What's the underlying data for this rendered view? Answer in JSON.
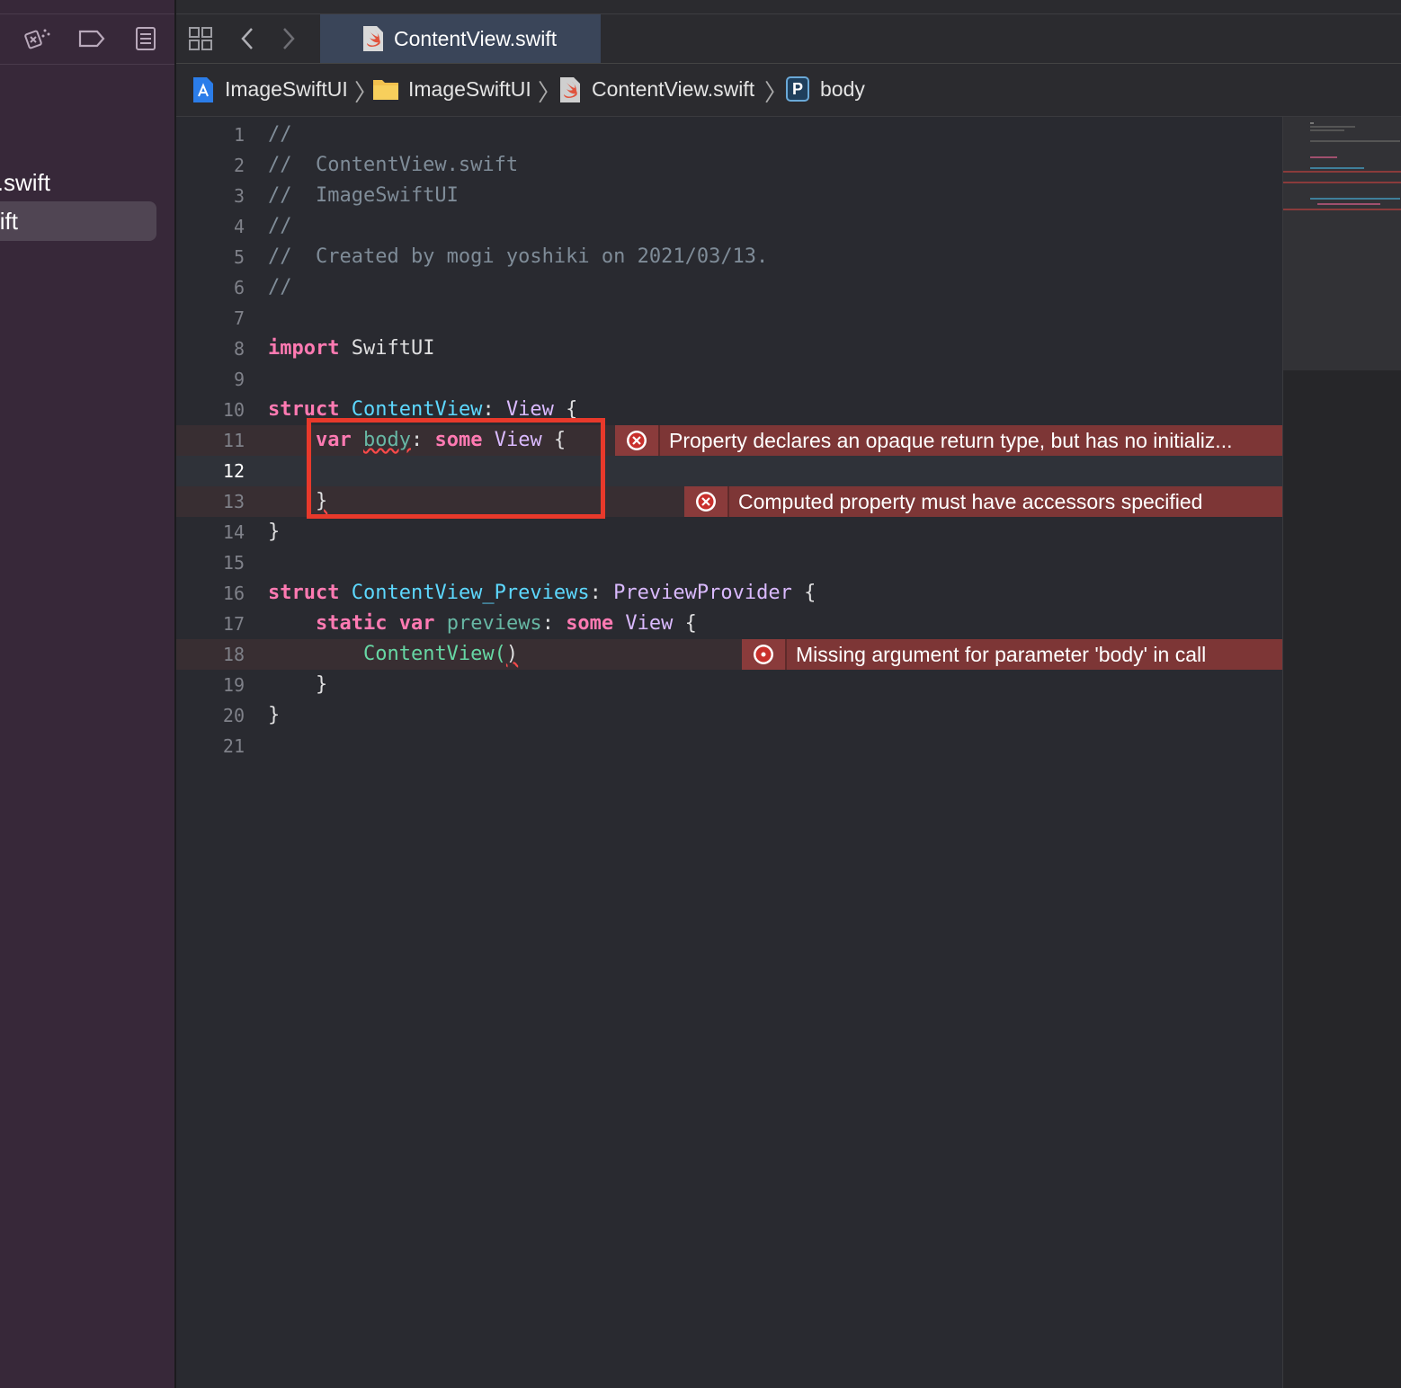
{
  "sidebar": {
    "files": [
      {
        "label": "p.swift",
        "selected": false
      },
      {
        "label": "ift",
        "selected": true
      }
    ],
    "icons": [
      "test-navigator-icon",
      "breakpoint-icon",
      "report-icon"
    ]
  },
  "tabbar": {
    "active_tab": "ContentView.swift",
    "icons": [
      "grid-icon",
      "back-icon",
      "forward-icon",
      "swift-file-icon"
    ]
  },
  "breadcrumb": {
    "items": [
      "ImageSwiftUI",
      "ImageSwiftUI",
      "ContentView.swift",
      "body"
    ],
    "property_badge": "P"
  },
  "editor": {
    "lines": [
      "1",
      "2",
      "3",
      "4",
      "5",
      "6",
      "7",
      "8",
      "9",
      "10",
      "11",
      "12",
      "13",
      "14",
      "15",
      "16",
      "17",
      "18",
      "19",
      "20",
      "21"
    ],
    "current_line": "12",
    "code": {
      "l1": "//",
      "l2": "//  ContentView.swift",
      "l3": "//  ImageSwiftUI",
      "l4": "//",
      "l5": "//  Created by mogi yoshiki on 2021/03/13.",
      "l6": "//",
      "import_kw": "import",
      "import_mod": " SwiftUI",
      "struct_kw": "struct",
      "cv_name": "ContentView",
      "colon": ": ",
      "view_ty": "View",
      "brace_open": " {",
      "var_kw": "var",
      "body_name": "body",
      "some_kw": "some",
      "brace_close": "}",
      "previews_name": "ContentView_Previews",
      "preview_provider": "PreviewProvider",
      "static_kw": "static",
      "previews_var": "previews",
      "call": "ContentView(",
      "call_close": ")"
    },
    "issues": [
      {
        "line": "11",
        "message": "Property declares an opaque return type, but has no initializ..."
      },
      {
        "line": "13",
        "message": "Computed property must have accessors specified"
      },
      {
        "line": "18",
        "message": "Missing argument for parameter 'body' in call"
      }
    ]
  },
  "colors": {
    "keyword": "#ff7ab2",
    "type": "#5dd8ff",
    "type_other": "#dabaff",
    "comment": "#7f8c98",
    "error_banner": "#7d3636",
    "highlight_box": "#e8392b"
  }
}
